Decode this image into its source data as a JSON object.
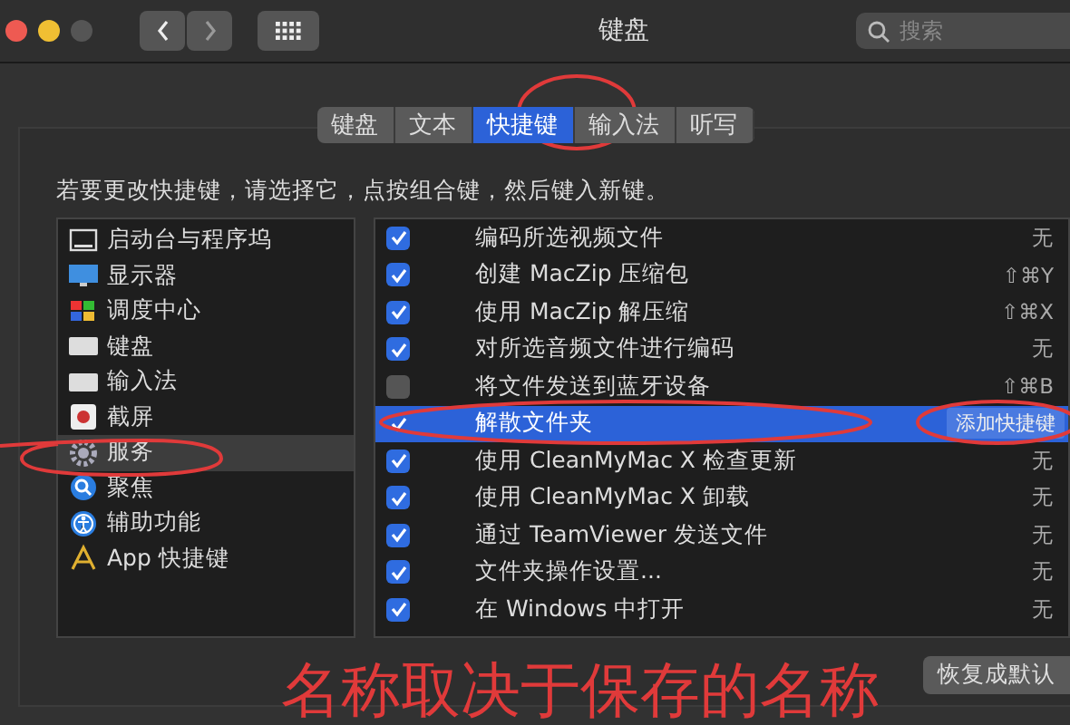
{
  "window": {
    "title": "键盘",
    "search": {
      "placeholder": "搜索"
    }
  },
  "tabs": [
    {
      "label": "键盘",
      "selected": false
    },
    {
      "label": "文本",
      "selected": false
    },
    {
      "label": "快捷键",
      "selected": true
    },
    {
      "label": "输入法",
      "selected": false
    },
    {
      "label": "听写",
      "selected": false
    }
  ],
  "instruction": "若要更改快捷键，请选择它，点按组合键，然后键入新键。",
  "categories": [
    {
      "label": "启动台与程序坞",
      "selected": false
    },
    {
      "label": "显示器",
      "selected": false
    },
    {
      "label": "调度中心",
      "selected": false
    },
    {
      "label": "键盘",
      "selected": false
    },
    {
      "label": "输入法",
      "selected": false
    },
    {
      "label": "截屏",
      "selected": false
    },
    {
      "label": "服务",
      "selected": true
    },
    {
      "label": "聚焦",
      "selected": false
    },
    {
      "label": "辅助功能",
      "selected": false
    },
    {
      "label": "App 快捷键",
      "selected": false
    }
  ],
  "shortcuts": [
    {
      "name": "编码所选视频文件",
      "shortcut": "无",
      "checked": true,
      "selected": false
    },
    {
      "name": "创建 MacZip 压缩包",
      "shortcut": "⇧⌘Y",
      "checked": true,
      "selected": false
    },
    {
      "name": "使用 MacZip 解压缩",
      "shortcut": "⇧⌘X",
      "checked": true,
      "selected": false
    },
    {
      "name": "对所选音频文件进行编码",
      "shortcut": "无",
      "checked": true,
      "selected": false
    },
    {
      "name": "将文件发送到蓝牙设备",
      "shortcut": "⇧⌘B",
      "checked": false,
      "selected": false
    },
    {
      "name": "解散文件夹",
      "add_button": "添加快捷键",
      "checked": true,
      "selected": true
    },
    {
      "name": "使用 CleanMyMac X 检查更新",
      "shortcut": "无",
      "checked": true,
      "selected": false
    },
    {
      "name": "使用 CleanMyMac X 卸载",
      "shortcut": "无",
      "checked": true,
      "selected": false
    },
    {
      "name": "通过 TeamViewer 发送文件",
      "shortcut": "无",
      "checked": true,
      "selected": false
    },
    {
      "name": "文件夹操作设置...",
      "shortcut": "无",
      "checked": true,
      "selected": false
    },
    {
      "name": "在 Windows 中打开",
      "shortcut": "无",
      "checked": true,
      "selected": false
    }
  ],
  "restore_button": "恢复成默认",
  "annotation": "名称取决于保存的名称"
}
